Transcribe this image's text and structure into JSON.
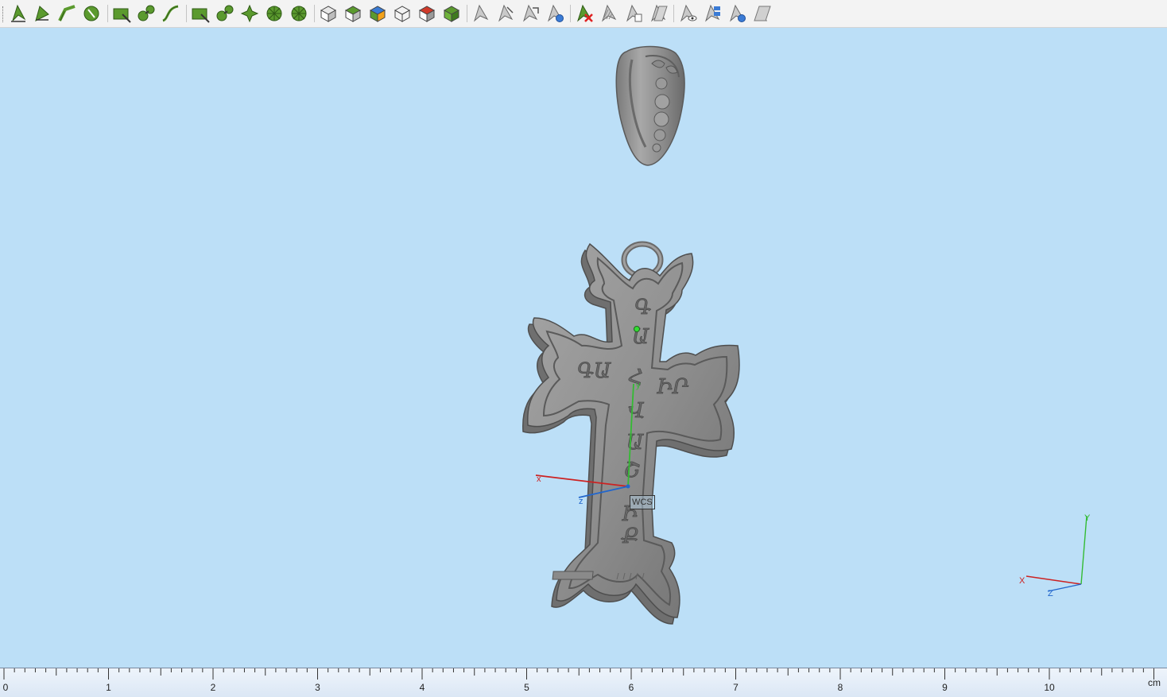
{
  "toolbar": {
    "groups": [
      [
        "select-icon",
        "select-face-icon",
        "select-edge-icon",
        "select-vertex-icon"
      ],
      [
        "rectangle-select-icon",
        "connected-select-icon",
        "curve-select-icon"
      ],
      [
        "fit-frame-icon",
        "node-select-icon",
        "cross-select-icon",
        "circle-select-icon",
        "lasso-select-icon"
      ],
      [
        "view-cube-icon",
        "view-cube-top-icon",
        "view-cube-colored-icon",
        "view-cube-wire-icon",
        "view-cube-red-icon",
        "view-cube-green-icon"
      ],
      [
        "pointer-icon",
        "pointer-arrows-icon",
        "pointer-move-icon",
        "pointer-sphere-icon"
      ],
      [
        "delete-pointer-icon",
        "hatched-pointer-icon",
        "pointer-copy-icon",
        "pointer-mirror-icon"
      ],
      [
        "pointer-eye-icon",
        "pointer-layers-icon",
        "pointer-dot-icon",
        "pointer-blank-icon"
      ]
    ]
  },
  "viewport": {
    "wcs_label": "WCS",
    "axis_x": "x",
    "axis_y": "y",
    "axis_z": "z",
    "corner_x": "X",
    "corner_y": "Y",
    "corner_z": "Z",
    "cross_letters": [
      "Գ",
      "Ա",
      "ԳԱ",
      "Հ",
      "ԻՐ",
      "Վ",
      "Ա",
      "Շ",
      "Ի",
      "Ք"
    ]
  },
  "ruler": {
    "labels": [
      "0",
      "1",
      "2",
      "3",
      "4",
      "5",
      "6",
      "7",
      "8",
      "9",
      "10"
    ],
    "unit": "cm"
  },
  "colors": {
    "viewport_bg": "#bcdff7",
    "model_gray": "#8c8c8c",
    "icon_green": "#5b9a2e",
    "axis_red": "#cc2222",
    "axis_green": "#33bb33",
    "axis_blue": "#2266cc"
  }
}
